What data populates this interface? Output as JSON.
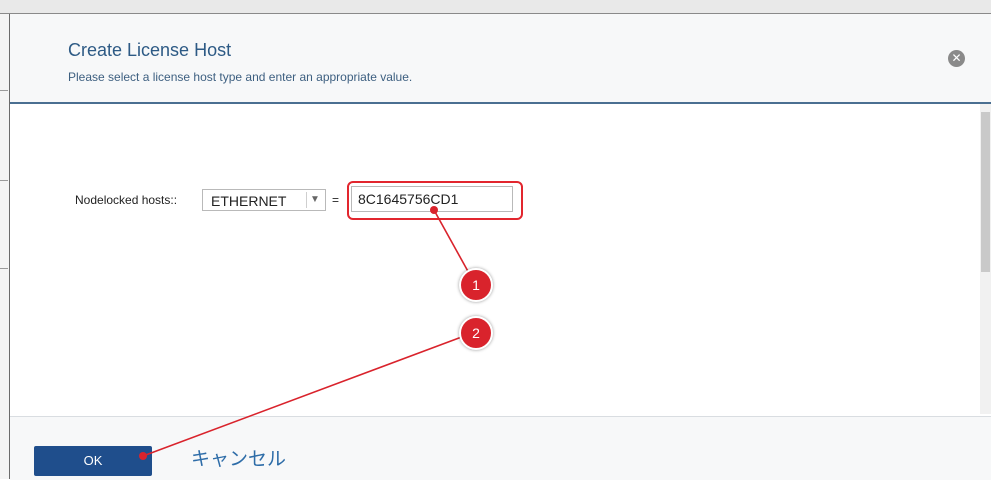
{
  "dialog": {
    "title": "Create License Host",
    "subtitle": "Please select a license host type and enter an appropriate value.",
    "close_icon": "close-circle-icon"
  },
  "form": {
    "label": "Nodelocked hosts::",
    "host_type_selected": "ETHERNET",
    "dropdown_icon": "chevron-down-icon",
    "equals": "=",
    "host_value": "8C1645756CD1"
  },
  "footer": {
    "ok_label": "OK",
    "cancel_label": "キャンセル"
  },
  "annotations": {
    "callout_1": "1",
    "callout_2": "2",
    "color": "#d9232c"
  }
}
